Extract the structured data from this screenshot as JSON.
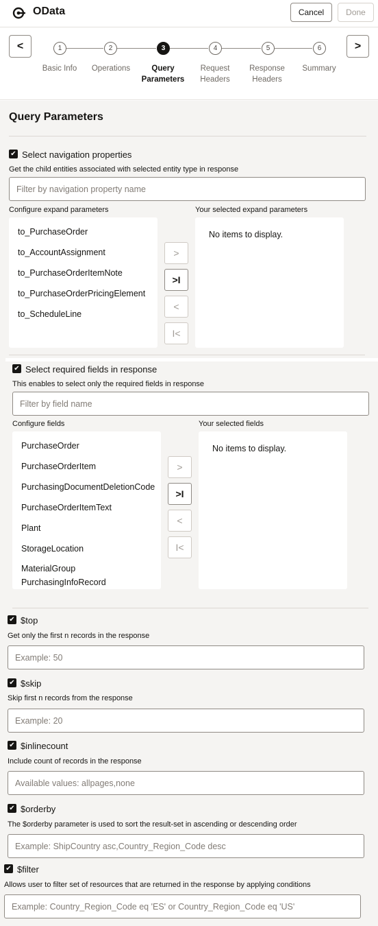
{
  "header": {
    "title": "OData",
    "cancel_label": "Cancel",
    "done_label": "Done"
  },
  "stepper": {
    "prev_label": "<",
    "next_label": ">",
    "steps": [
      {
        "num": "1",
        "label": "Basic Info"
      },
      {
        "num": "2",
        "label": "Operations"
      },
      {
        "num": "3",
        "label": "Query Parameters",
        "active": true
      },
      {
        "num": "4",
        "label": "Request Headers"
      },
      {
        "num": "5",
        "label": "Response Headers"
      },
      {
        "num": "6",
        "label": "Summary"
      }
    ]
  },
  "section": {
    "title": "Query Parameters"
  },
  "navigation": {
    "checkbox_label": "Select navigation properties",
    "hint": "Get the child entities associated with selected entity type in response",
    "filter_placeholder": "Filter by navigation property name",
    "available_header": "Configure expand parameters",
    "selected_header": "Your selected expand parameters",
    "available_items": [
      "to_PurchaseOrder",
      "to_AccountAssignment",
      "to_PurchaseOrderItemNote",
      "to_PurchaseOrderPricingElement",
      "to_ScheduleLine"
    ],
    "empty_message": "No items to display."
  },
  "fields": {
    "checkbox_label": "Select required fields in response",
    "hint": "This enables to select only the required fields in response",
    "filter_placeholder": "Filter by field name",
    "available_header": "Configure fields",
    "selected_header": "Your selected fields",
    "available_items": [
      "PurchaseOrder",
      "PurchaseOrderItem",
      "PurchasingDocumentDeletionCode",
      "PurchaseOrderItemText",
      "Plant",
      "StorageLocation",
      "MaterialGroup",
      "PurchasingInfoRecord"
    ],
    "empty_message": "No items to display."
  },
  "shuttle": {
    "move_right": ">",
    "move_all_right": ">I",
    "move_left": "<",
    "move_all_left": "I<"
  },
  "params": [
    {
      "label": "$top",
      "hint": "Get only the first n records in the response",
      "placeholder": "Example: 50"
    },
    {
      "label": "$skip",
      "hint": "Skip first n records from the response",
      "placeholder": "Example: 20"
    },
    {
      "label": "$inlinecount",
      "hint": "Include count of records in the response",
      "placeholder": "Available values: allpages,none"
    },
    {
      "label": "$orderby",
      "hint": "The $orderby parameter is used to sort the result-set in ascending or descending order",
      "placeholder": "Example: ShipCountry asc,Country_Region_Code desc"
    },
    {
      "label": "$filter",
      "hint": "Allows user to filter set of resources that are returned in the response by applying conditions",
      "placeholder": "Example: Country_Region_Code eq 'ES' or Country_Region_Code eq 'US'"
    }
  ],
  "colors": {
    "accent": "#161513",
    "background": "#f5f4f2",
    "border": "#8f8a84"
  }
}
